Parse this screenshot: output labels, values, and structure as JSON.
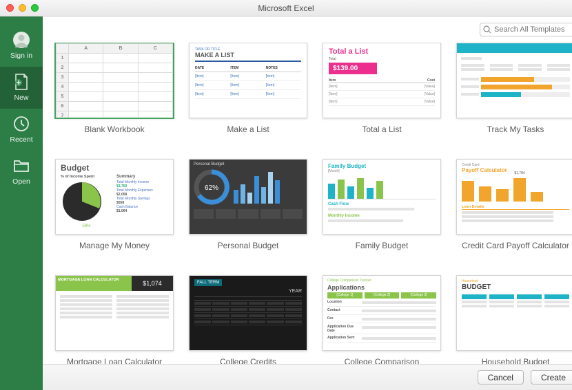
{
  "window": {
    "title": "Microsoft Excel"
  },
  "search": {
    "placeholder": "Search All Templates"
  },
  "sidebar": {
    "items": [
      {
        "label": "Sign in",
        "icon": "user"
      },
      {
        "label": "New",
        "icon": "new-doc"
      },
      {
        "label": "Recent",
        "icon": "clock"
      },
      {
        "label": "Open",
        "icon": "folder"
      }
    ],
    "activeIndex": 1
  },
  "templates": [
    {
      "label": "Blank Workbook",
      "kind": "blank",
      "selected": true
    },
    {
      "label": "Make a List",
      "kind": "list",
      "heading": "MAKE A LIST",
      "subhead": "TASK OR TITLE",
      "cols": [
        "DATE",
        "ITEM",
        "NOTES"
      ]
    },
    {
      "label": "Total a List",
      "kind": "total",
      "heading": "Total a List",
      "total": "$139.00",
      "rows": [
        "Item",
        "[Item]",
        "[Item]",
        "[Item]"
      ],
      "col2": "Cost"
    },
    {
      "label": "Track My Tasks",
      "kind": "tasks"
    },
    {
      "label": "Manage My Money",
      "kind": "money",
      "heading": "Budget",
      "left": "% of Income Spent",
      "pct": "59%",
      "right": "Summary",
      "lines": [
        "Total Monthly Income",
        "$3,750",
        "Total Monthly Expenses",
        "$2,058",
        "Total Monthly Savings",
        "$558",
        "Cash Balance",
        "$1,064"
      ]
    },
    {
      "label": "Personal Budget",
      "kind": "personal",
      "heading": "Personal Budget",
      "pct": "62%"
    },
    {
      "label": "Family Budget",
      "kind": "family",
      "heading": "Family Budget",
      "sub": "[Month]",
      "s1": "Cash Flow",
      "s2": "Monthly Income"
    },
    {
      "label": "Credit Card Payoff Calculator",
      "kind": "credit",
      "heading": "Credit Card",
      "sub": "Payoff Calculator",
      "val": "$1,784",
      "s1": "Loan Details"
    },
    {
      "label": "Mortgage Loan Calculator",
      "kind": "mortgage",
      "heading": "MORTGAGE LOAN CALCULATOR",
      "val": "$1,074"
    },
    {
      "label": "College Credits",
      "kind": "college_credits",
      "heading": "FALL TERM",
      "sub": "YEAR"
    },
    {
      "label": "College Comparison",
      "kind": "college_comp",
      "heading": "Applications",
      "top": "College Comparison Tracker",
      "rows": [
        "Location",
        "Contact",
        "Fee",
        "Application Due Date",
        "Application Sent"
      ]
    },
    {
      "label": "Household Budget",
      "kind": "hbudget",
      "heading": "BUDGET",
      "top": "Household"
    }
  ],
  "footer": {
    "cancel": "Cancel",
    "create": "Create"
  },
  "colors": {
    "brand": "#2d7d46",
    "pink": "#ec2e8d",
    "teal": "#1eb3c6",
    "orange": "#f2a52c",
    "blue": "#3a8fd8",
    "green2": "#8bc44a"
  }
}
